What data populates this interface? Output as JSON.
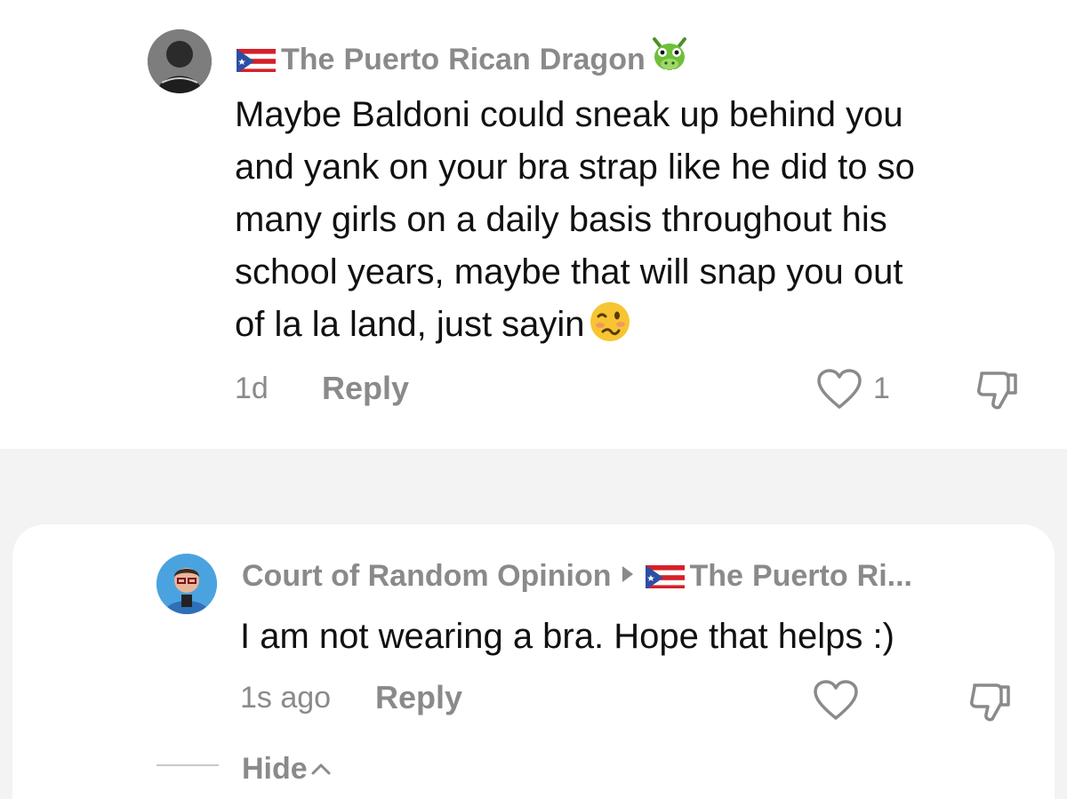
{
  "comment": {
    "username": [
      "The",
      "Puerto",
      "Rican",
      "Dragon"
    ],
    "username_emoji": "dragon-face",
    "text_lines": [
      "Maybe Baldoni could sneak up behind you",
      "and yank on your bra strap like he did to so",
      "many girls on a daily basis throughout his",
      "school years, maybe that will snap you out",
      "of la la land, just sayin"
    ],
    "trailing_emoji": "woozy-face",
    "timestamp": "1d",
    "reply_label": "Reply",
    "like_count": "1"
  },
  "reply": {
    "author": "Court of Random Opinion",
    "replying_to": [
      "The",
      "Puerto",
      "Ri..."
    ],
    "text": "I am not wearing a bra. Hope that helps :)",
    "timestamp": "1s ago",
    "reply_label": "Reply"
  },
  "thread": {
    "hide_label": "Hide"
  },
  "colors": {
    "muted_text": "#8a8a8a",
    "body_text": "#111111",
    "background": "#f3f3f3",
    "card": "#ffffff"
  }
}
